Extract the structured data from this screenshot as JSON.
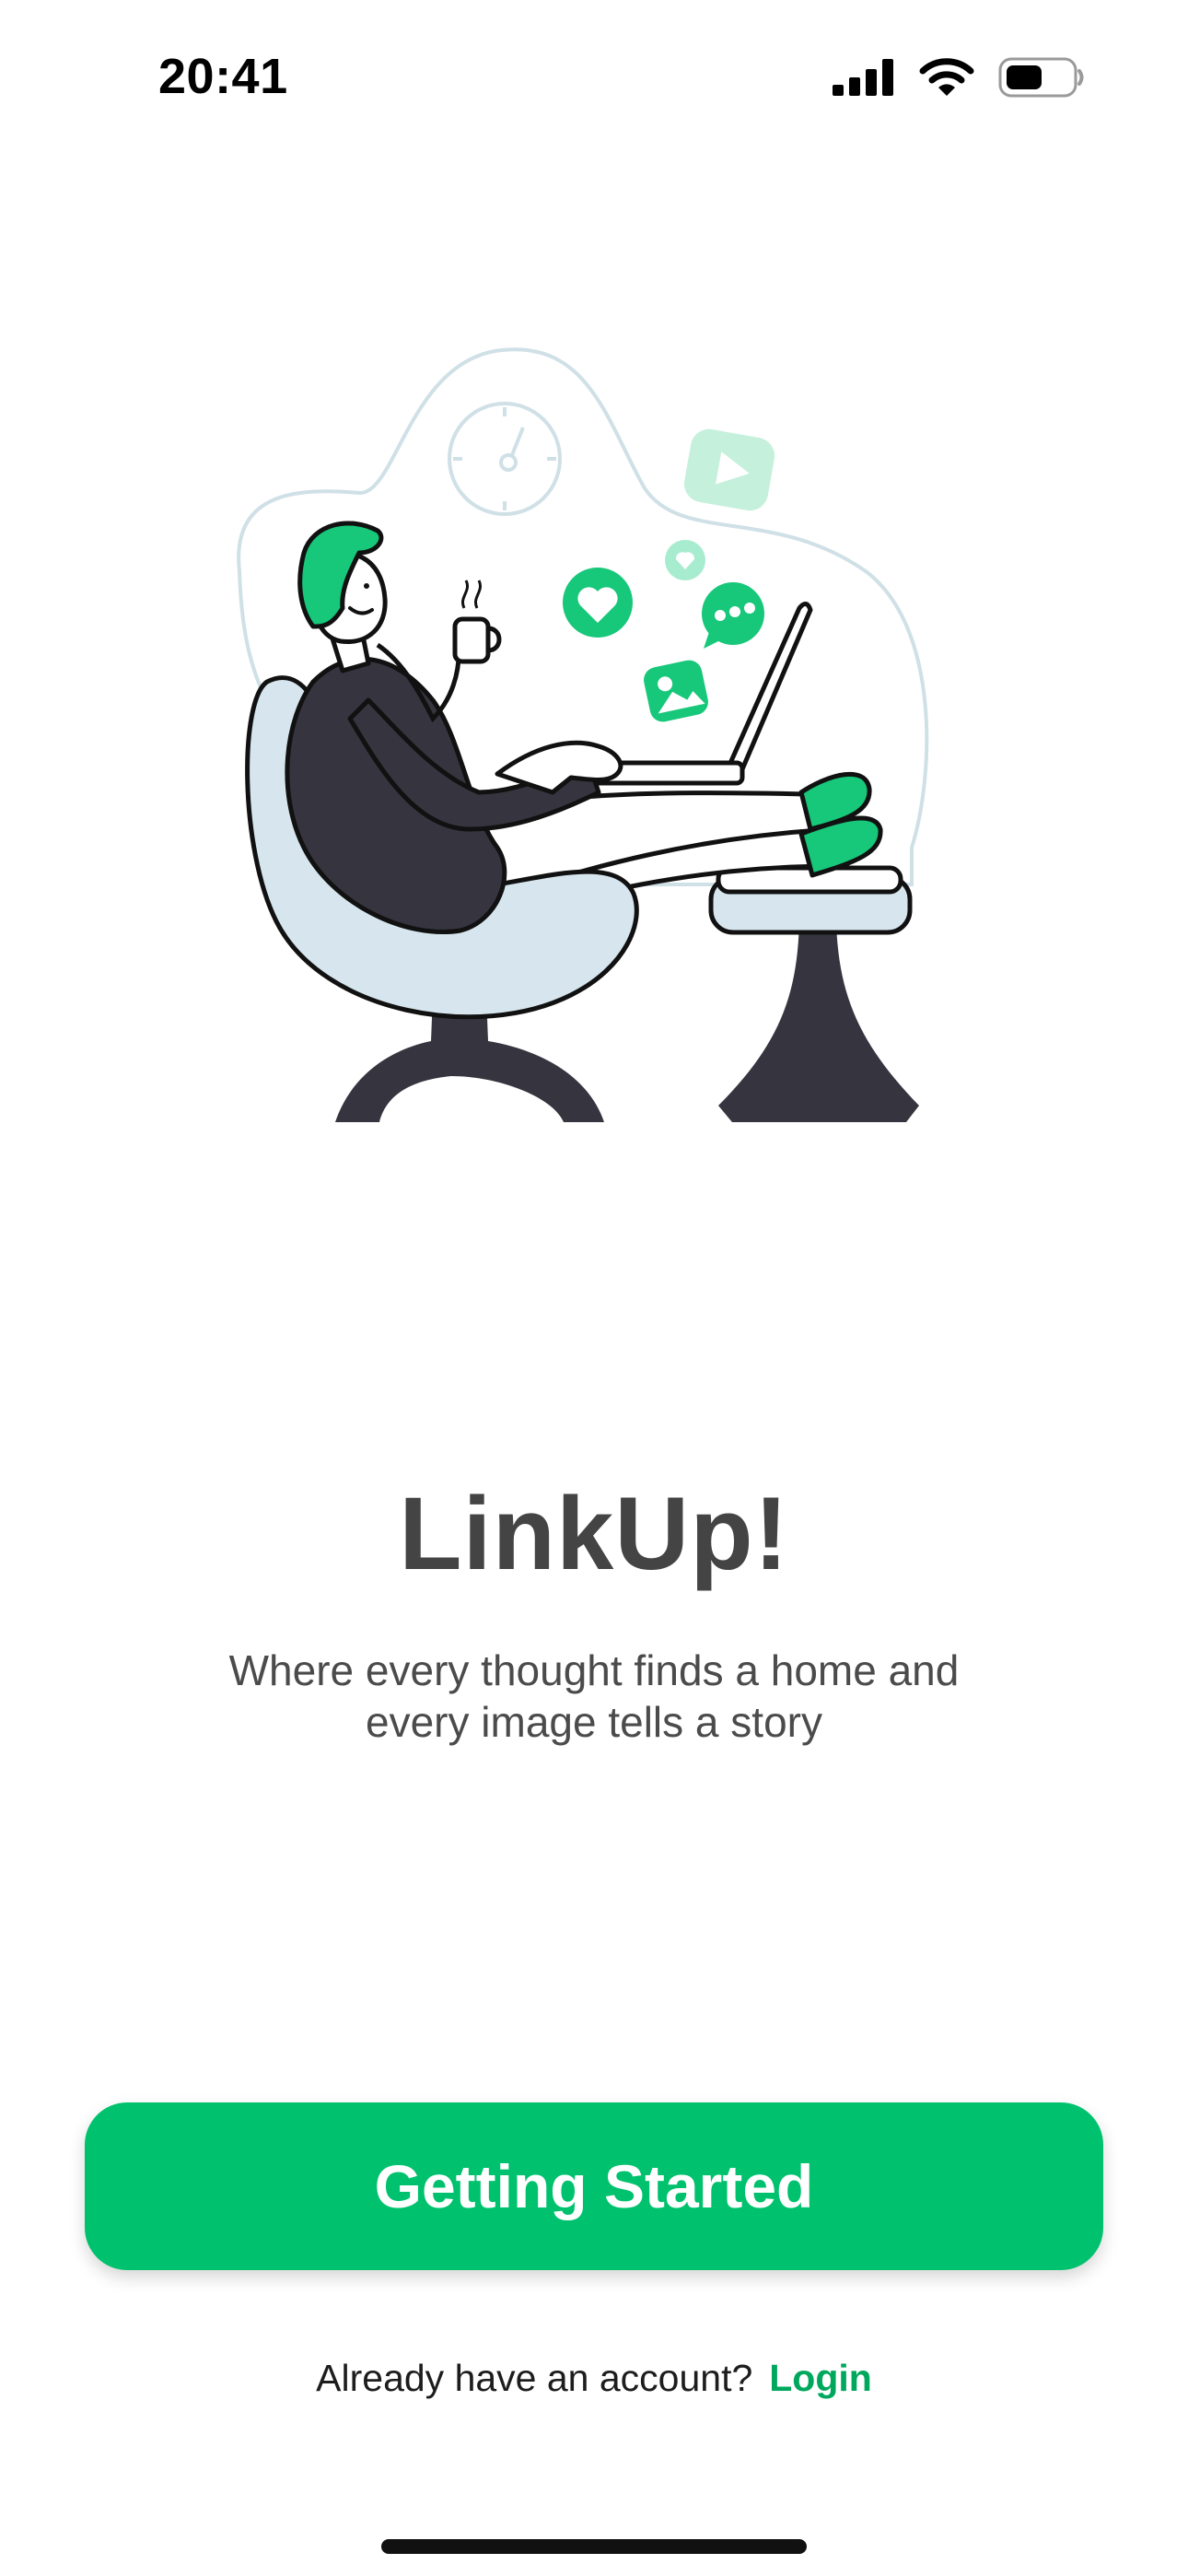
{
  "status_bar": {
    "time": "20:41",
    "icons": [
      "cellular-signal-icon",
      "wifi-icon",
      "battery-icon"
    ]
  },
  "illustration": {
    "subject": "person-relaxing-with-laptop-illustration",
    "icons": [
      "clock-icon",
      "heart-icon",
      "chat-bubble-icon",
      "image-icon",
      "play-icon"
    ]
  },
  "app": {
    "title": "LinkUp!",
    "tagline_line1": "Where every thought finds a home and",
    "tagline_line2": "every image tells a story"
  },
  "actions": {
    "primary_button": "Getting Started",
    "login_prompt": "Already have an account?",
    "login_link": "Login"
  },
  "colors": {
    "accent": "#00c26e",
    "link": "#00a85e",
    "title": "#444444",
    "chair": "#d7e6ee",
    "dark": "#36353f"
  }
}
